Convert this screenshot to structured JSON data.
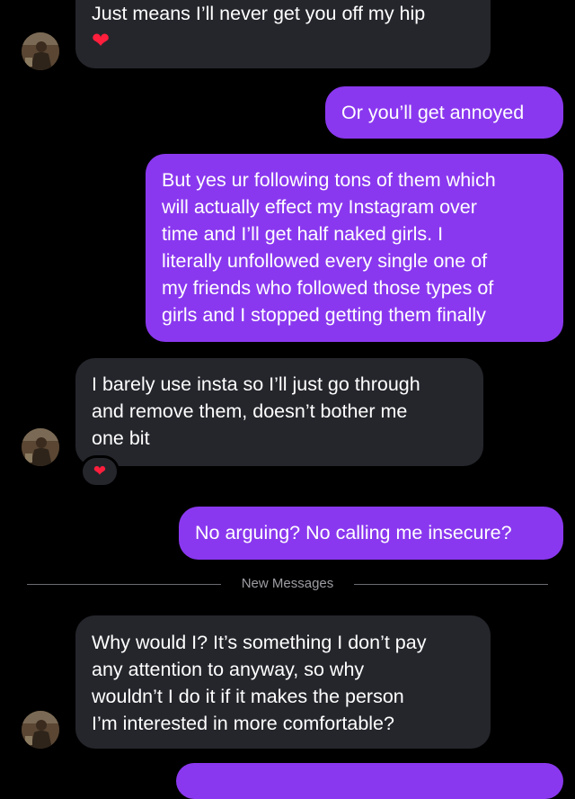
{
  "messages": {
    "m1": {
      "lines": [
        "Just means I’ll never get you off my hip"
      ],
      "emoji": "❤"
    },
    "m2": {
      "text": "Or you’ll get annoyed"
    },
    "m3": {
      "lines": [
        "But yes ur following tons of them which",
        "will actually effect my Instagram over",
        "time and I’ll get half naked girls. I",
        "literally unfollowed every single one of",
        "my friends who followed those types of",
        "girls and I stopped getting them finally"
      ]
    },
    "m4": {
      "lines": [
        "I barely use insta so I’ll just go through",
        "and remove them, doesn’t bother me",
        "one bit"
      ],
      "reaction": "❤"
    },
    "m5": {
      "text": "No arguing? No calling me insecure?"
    },
    "divider": {
      "label": "New Messages"
    },
    "m6": {
      "lines": [
        "Why would I? It’s something I don’t pay",
        "any attention to anyway, so why",
        "wouldn’t I do it if it makes the person",
        "I’m interested in more comfortable?"
      ]
    }
  },
  "colors": {
    "incoming": "#25262c",
    "outgoing": "#8a38ef",
    "heart": "#ff1f3d",
    "background": "#000000"
  },
  "icons": {
    "avatar": "contact-avatar-photo",
    "reaction": "red-heart-emoji"
  }
}
